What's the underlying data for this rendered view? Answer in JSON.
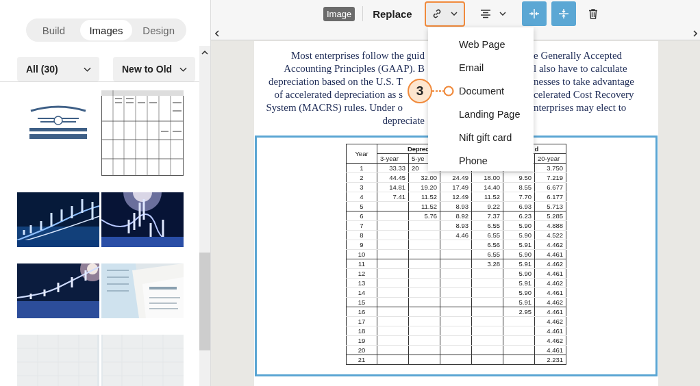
{
  "sidebar": {
    "tabs": [
      {
        "label": "Build",
        "selected": false
      },
      {
        "label": "Images",
        "selected": true
      },
      {
        "label": "Design",
        "selected": false
      }
    ],
    "filters": [
      {
        "label": "All (30)"
      },
      {
        "label": "New to Old"
      }
    ]
  },
  "toolbar": {
    "items": [
      {
        "kind": "badge",
        "label": "Image"
      },
      {
        "kind": "text-button",
        "label": "Replace"
      },
      {
        "kind": "link",
        "highlighted": true
      },
      {
        "kind": "align",
        "highlighted": false
      },
      {
        "kind": "stretch-width",
        "on": true
      },
      {
        "kind": "stretch-height",
        "on": true
      },
      {
        "kind": "delete"
      }
    ]
  },
  "link_menu": {
    "items": [
      {
        "label": "Web Page"
      },
      {
        "label": "Email"
      },
      {
        "label": "Document"
      },
      {
        "label": "Landing Page"
      },
      {
        "label": "Nift gift card"
      },
      {
        "label": "Phone"
      }
    ],
    "callout": {
      "label": "3"
    }
  },
  "document": {
    "paragraph": [
      {
        "left": "Most enterprises follow the guid",
        "right": "e Generally Accepted"
      },
      {
        "left": "Accounting Principles (GAAP). B",
        "right": "l also have to calculate"
      },
      {
        "left": "depreciation based on the U.S. T",
        "right": "nesses to take advantage"
      },
      {
        "left": "of accelerated depreciation as s",
        "right": "celerated Cost Recovery"
      },
      {
        "left": "System (MACRS) rules. Under o",
        "right": "nterprises may elect to"
      },
      {
        "left": "depreciate"
      }
    ],
    "table": {
      "year_heading": "Year",
      "group_heading_left": "Deprec",
      "group_heading_right": "d",
      "columns": [
        null,
        "3-year",
        "5-ye",
        null,
        null,
        null,
        "20-year"
      ],
      "rows": [
        [
          "1",
          "33.33",
          {
            "text": "20",
            "cut": true
          },
          null,
          null,
          null,
          "3.750"
        ],
        [
          "2",
          "44.45",
          "32.00",
          "24.49",
          "18.00",
          "9.50",
          "7.219"
        ],
        [
          "3",
          "14.81",
          "19.20",
          "17.49",
          "14.40",
          "8.55",
          "6.677"
        ],
        [
          "4",
          "7.41",
          "11.52",
          "12.49",
          "11.52",
          "7.70",
          "6.177"
        ],
        [
          "5",
          null,
          "11.52",
          "8.93",
          "9.22",
          "6.93",
          "5.713"
        ],
        [
          "6",
          null,
          "5.76",
          "8.92",
          "7.37",
          "6.23",
          "5.285"
        ],
        [
          "7",
          null,
          null,
          "8.93",
          "6.55",
          "5.90",
          "4.888"
        ],
        [
          "8",
          null,
          null,
          "4.46",
          "6.55",
          "5.90",
          "4.522"
        ],
        [
          "9",
          null,
          null,
          null,
          "6.56",
          "5.91",
          "4.462"
        ],
        [
          "10",
          null,
          null,
          null,
          "6.55",
          "5.90",
          "4.461"
        ],
        [
          "11",
          null,
          null,
          null,
          "3.28",
          "5.91",
          "4.462"
        ],
        [
          "12",
          null,
          null,
          null,
          null,
          "5.90",
          "4.461"
        ],
        [
          "13",
          null,
          null,
          null,
          null,
          "5.91",
          "4.462"
        ],
        [
          "14",
          null,
          null,
          null,
          null,
          "5.90",
          "4.461"
        ],
        [
          "15",
          null,
          null,
          null,
          null,
          "5.91",
          "4.462"
        ],
        [
          "16",
          null,
          null,
          null,
          null,
          "2.95",
          "4.461"
        ],
        [
          "17",
          null,
          null,
          null,
          null,
          null,
          "4.462"
        ],
        [
          "18",
          null,
          null,
          null,
          null,
          null,
          "4.461"
        ],
        [
          "19",
          null,
          null,
          null,
          null,
          null,
          "4.462"
        ],
        [
          "20",
          null,
          null,
          null,
          null,
          null,
          "4.461"
        ],
        [
          "21",
          null,
          null,
          null,
          null,
          null,
          "2.231"
        ]
      ]
    }
  }
}
